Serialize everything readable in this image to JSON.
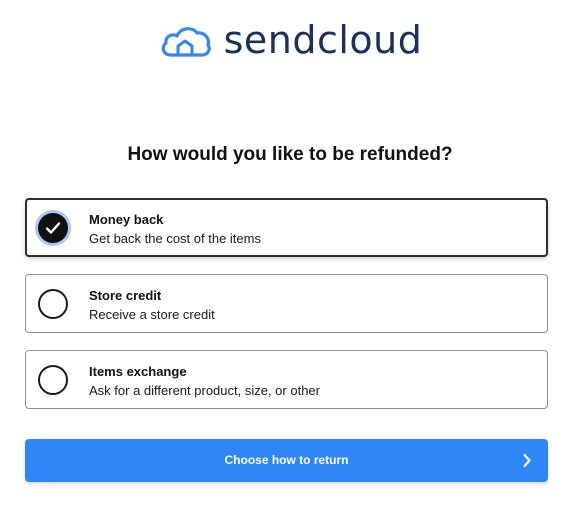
{
  "brand": {
    "name": "sendcloud",
    "logo_icon": "cloud-icon",
    "color": "#1b2f5c",
    "icon_color": "#2f86f5"
  },
  "page": {
    "heading": "How would you like to be refunded?"
  },
  "options": [
    {
      "title": "Money back",
      "description": "Get back the cost of the items",
      "selected": true
    },
    {
      "title": "Store credit",
      "description": "Receive a store credit",
      "selected": false
    },
    {
      "title": "Items exchange",
      "description": "Ask for a different product, size, or other",
      "selected": false
    }
  ],
  "cta": {
    "label": "Choose how to return",
    "icon": "chevron-right-icon",
    "color": "#2f86f5"
  }
}
